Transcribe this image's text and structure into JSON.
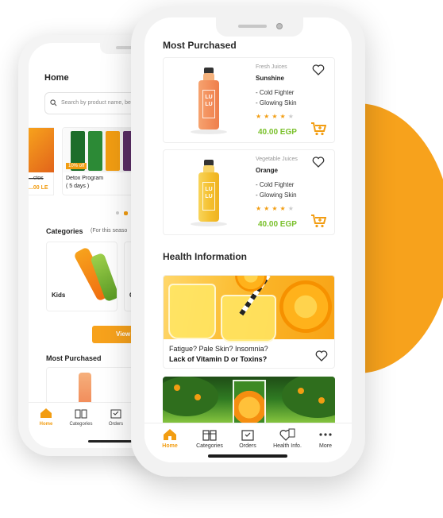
{
  "colors": {
    "accent": "#f29d12",
    "price_green": "#7ac02b",
    "blob": "#f7a21c"
  },
  "back_phone": {
    "title": "Home",
    "search_placeholder": "Search by product name, be",
    "offer_old_price": "...ctos",
    "offer_price": "...00 LE",
    "detox_badge": "10% off",
    "detox_title": "Detox Program",
    "detox_duration": "( 5 days )",
    "categories_title": "Categories",
    "categories_subtitle": "(For this seaso",
    "category_kids": "Kids",
    "category_second": "C",
    "view_all": "View A",
    "most_purchased": "Most Purchased",
    "nav": {
      "home": "Home",
      "categories": "Categories",
      "orders": "Orders"
    }
  },
  "front_phone": {
    "most_purchased_title": "Most Purchased",
    "products": [
      {
        "category": "Fresh Juices",
        "name": "Sunshine",
        "benefits": [
          "- Cold Fighter",
          "- Glowing Skin"
        ],
        "rating": 4,
        "price": "40.00 EGP",
        "label": "LU LU"
      },
      {
        "category": "Vegetable Juices",
        "name": "Orange",
        "benefits": [
          "- Cold Fighter",
          "- Glowing Skin"
        ],
        "rating": 4,
        "price": "40.00 EGP",
        "label": "LU LU"
      }
    ],
    "health_title": "Health Information",
    "health_card": {
      "question": "Fatigue? Pale Skin? Insomnia?",
      "headline": "Lack of Vitamin D or Toxins?"
    },
    "nav": {
      "home": "Home",
      "categories": "Categories",
      "orders": "Orders",
      "health": "Health Info.",
      "more": "More"
    }
  }
}
